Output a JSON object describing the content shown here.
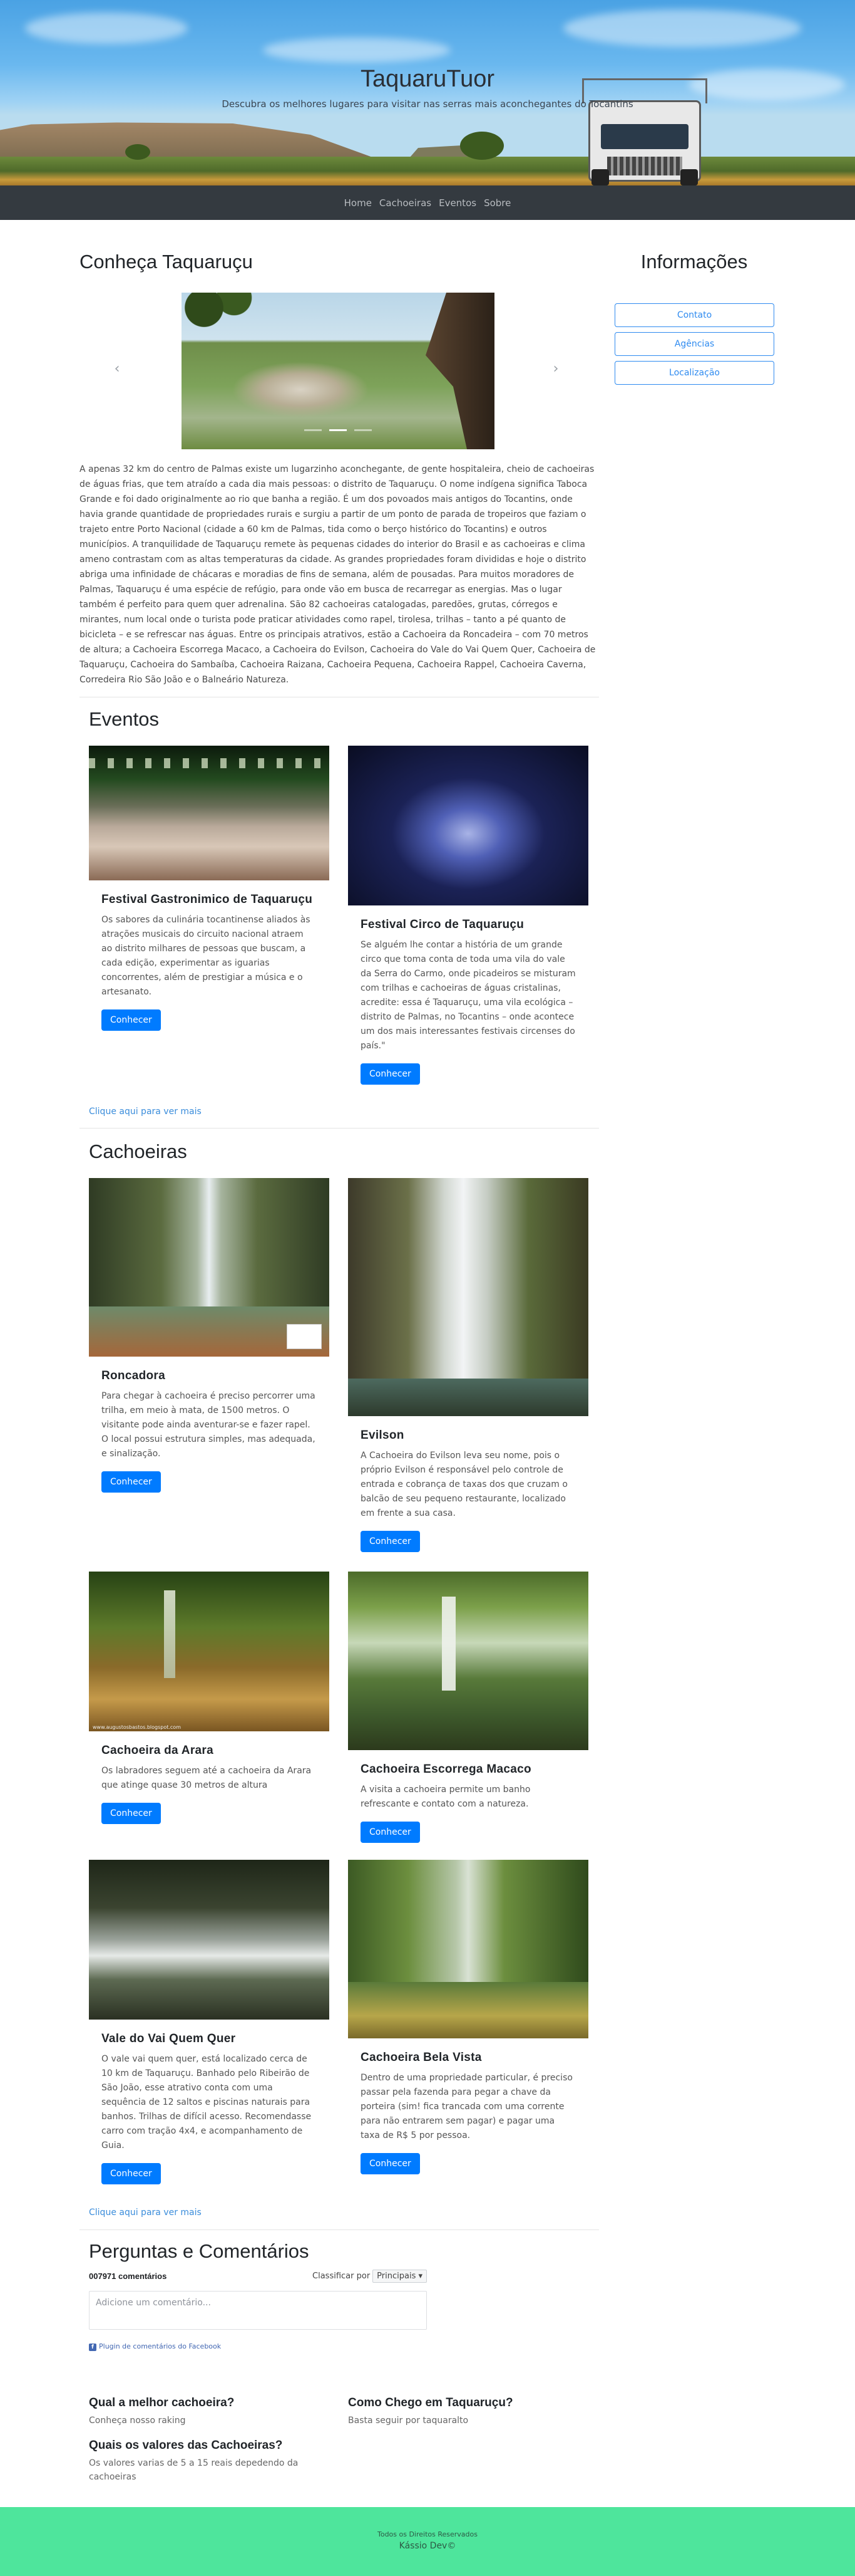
{
  "header": {
    "title": "TaquaruTuor",
    "subtitle": "Descubra os melhores lugares para visitar nas serras mais aconchegantes do Tocantins"
  },
  "nav": {
    "items": [
      "Home",
      "Cachoeiras",
      "Eventos",
      "Sobre"
    ]
  },
  "conheca": {
    "title": "Conheça Taquaruçu",
    "text": "A apenas 32 km do centro de Palmas existe um lugarzinho aconchegante, de gente hospitaleira, cheio de cachoeiras de águas frias, que tem atraído a cada dia mais pessoas: o distrito de Taquaruçu. O nome indígena significa Taboca Grande e foi dado originalmente ao rio que banha a região. É um dos povoados mais antigos do Tocantins, onde havia grande quantidade de propriedades rurais e surgiu a partir de um ponto de parada de tropeiros que faziam o trajeto entre Porto Nacional (cidade a 60 km de Palmas, tida como o berço histórico do Tocantins) e outros municípios. A tranquilidade de Taquaruçu remete às pequenas cidades do interior do Brasil e as cachoeiras e clima ameno contrastam com as altas temperaturas da cidade. As grandes propriedades foram divididas e hoje o distrito abriga uma infinidade de chácaras e moradias de fins de semana, além de pousadas. Para muitos moradores de Palmas, Taquaruçu é uma espécie de refúgio, para onde vão em busca de recarregar as energias. Mas o lugar também é perfeito para quem quer adrenalina. São 82 cachoeiras catalogadas, paredões, grutas, córregos e mirantes, num local onde o turista pode praticar atividades como rapel, tirolesa, trilhas – tanto a pé quanto de bicicleta – e se refrescar nas águas. Entre os principais atrativos, estão a Cachoeira da Roncadeira – com 70 metros de altura; a Cachoeira Escorrega Macaco, a Cachoeira do Evilson, Cachoeira do Vale do Vai Quem Quer, Cachoeira de Taquaruçu, Cachoeira do Sambaíba, Cachoeira Raizana, Cachoeira Pequena, Cachoeira Rappel, Cachoeira Caverna, Corredeira Rio São João e o Balneário Natureza.",
    "carousel": {
      "prev_icon": "‹",
      "next_icon": "›",
      "indicator_count": 3,
      "active_indicator": 1
    }
  },
  "sidebar": {
    "title": "Informações",
    "buttons": [
      "Contato",
      "Agências",
      "Localização"
    ]
  },
  "eventos": {
    "title": "Eventos",
    "cards": [
      {
        "title": "Festival Gastronimico de Taquaruçu",
        "text": "Os sabores da culinária tocantinense aliados às atrações musicais do circuito nacional atraem ao distrito milhares de pessoas que buscam, a cada edição, experimentar as iguarias concorrentes, além de prestigiar a música e o artesanato.",
        "button": "Conhecer"
      },
      {
        "title": "Festival Circo de Taquaruçu",
        "text": "Se alguém lhe contar a história de um grande circo que toma conta de toda uma vila do vale da Serra do Carmo, onde picadeiros se misturam com trilhas e cachoeiras de águas cristalinas, acredite: essa é Taquaruçu, uma vila ecológica – distrito de Palmas, no Tocantins – onde acontece um dos mais interessantes festivais circenses do país.\"",
        "button": "Conhecer"
      }
    ],
    "more": "Clique aqui para ver mais"
  },
  "cachoeiras": {
    "title": "Cachoeiras",
    "cards": [
      {
        "title": "Roncadora",
        "text": "Para chegar à cachoeira é preciso percorrer uma trilha, em meio à mata, de 1500 metros. O visitante pode ainda aventurar-se e fazer rapel. O local possui estrutura simples, mas adequada, e sinalização.",
        "button": "Conhecer"
      },
      {
        "title": "Evilson",
        "text": "A Cachoeira do Evilson leva seu nome, pois o próprio Evilson é responsável pelo controle de entrada e cobrança de taxas dos que cruzam o balcão de seu pequeno restaurante, localizado em frente a sua casa.",
        "button": "Conhecer"
      },
      {
        "title": "Cachoeira da Arara",
        "text": "Os labradores seguem até a cachoeira da Arara que atinge quase 30 metros de altura",
        "button": "Conhecer",
        "watermark": "www.augustosbastos.blogspot.com"
      },
      {
        "title": "Cachoeira Escorrega Macaco",
        "text": "A visita a cachoeira permite um banho refrescante e contato com a natureza.",
        "button": "Conhecer"
      },
      {
        "title": "Vale do Vai Quem Quer",
        "text": "O vale vai quem quer, está localizado cerca de 10 km de Taquaruçu. Banhado pelo Ribeirão de São João, esse atrativo conta com uma sequência de 12 saltos e piscinas naturais para banhos. Trilhas de difícil acesso. Recomendasse carro com tração 4x4, e acompanhamento de Guia.",
        "button": "Conhecer"
      },
      {
        "title": "Cachoeira Bela Vista",
        "text": "Dentro de uma propriedade particular, é preciso passar pela fazenda para pegar a chave da porteira (sim! fica trancada com uma corrente para não entrarem sem pagar) e pagar uma taxa de R$ 5 por pessoa.",
        "button": "Conhecer"
      }
    ],
    "more": "Clique aqui para ver mais"
  },
  "comentarios": {
    "title": "Perguntas e Comentários",
    "count": "007971 comentários",
    "sort_label": "Classificar por",
    "sort_value": "Principais ▾",
    "placeholder": "Adicione um comentário...",
    "plugin": "Plugin de comentários do Facebook",
    "faq": [
      {
        "q": "Qual a melhor cachoeira?",
        "a": "Conheça nosso raking"
      },
      {
        "q": "Como Chego em Taquaruçu?",
        "a": "Basta seguir por taquaralto"
      },
      {
        "q": "Quais os valores das Cachoeiras?",
        "a": "Os valores varias de 5 a 15 reais depedendo da cachoeiras"
      }
    ]
  },
  "footer": {
    "rights": "Todos os Direitos Reservados",
    "author": "Kássio Dev©"
  }
}
